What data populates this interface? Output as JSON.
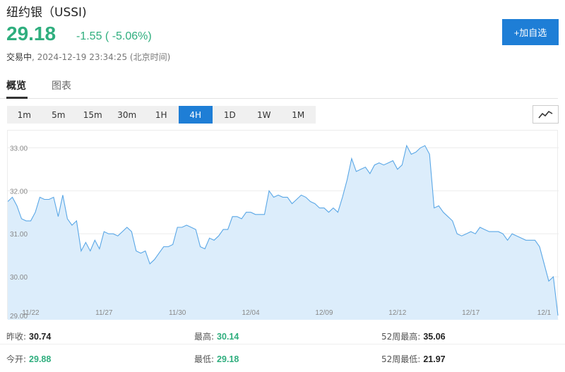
{
  "header": {
    "title": "纽约银（USSI)",
    "price": "29.18",
    "change": "-1.55 ( -5.06%)",
    "status_label": "交易中",
    "timestamp": "2024-12-19 23:34:25 (北京时间)",
    "add_button": "+加自选"
  },
  "tabs": [
    {
      "label": "概览",
      "active": true
    },
    {
      "label": "图表",
      "active": false
    }
  ],
  "periods": [
    {
      "label": "1m"
    },
    {
      "label": "5m"
    },
    {
      "label": "15m"
    },
    {
      "label": "30m"
    },
    {
      "label": "1H"
    },
    {
      "label": "4H",
      "active": true
    },
    {
      "label": "1D"
    },
    {
      "label": "1W"
    },
    {
      "label": "1M"
    }
  ],
  "chart_type_icon": "line-chart-icon",
  "colors": {
    "up_green": "#2fae7e",
    "accent_blue": "#1e7ed6",
    "line": "#5aa7e6",
    "fill": "#dcedfb"
  },
  "stats": {
    "prev_close_label": "昨收:",
    "prev_close": "30.74",
    "high_label": "最高:",
    "high": "30.14",
    "high52_label": "52周最高:",
    "high52": "35.06",
    "open_label": "今开:",
    "open": "29.88",
    "low_label": "最低:",
    "low": "29.18",
    "low52_label": "52周最低:",
    "low52": "21.97"
  },
  "chart_data": {
    "type": "area",
    "ylim": [
      29.0,
      33.4
    ],
    "y_ticks": [
      "33.00",
      "32.00",
      "31.00",
      "30.00",
      "29.00"
    ],
    "x_ticks": [
      {
        "label": "11/22",
        "index": 5
      },
      {
        "label": "11/27",
        "index": 21
      },
      {
        "label": "11/30",
        "index": 37
      },
      {
        "label": "12/04",
        "index": 53
      },
      {
        "label": "12/09",
        "index": 69
      },
      {
        "label": "12/12",
        "index": 85
      },
      {
        "label": "12/17",
        "index": 101
      },
      {
        "label": "12/1",
        "index": 117
      }
    ],
    "values": [
      31.75,
      31.85,
      31.65,
      31.35,
      31.3,
      31.3,
      31.5,
      31.85,
      31.8,
      31.8,
      31.85,
      31.4,
      31.9,
      31.35,
      31.2,
      31.3,
      30.6,
      30.8,
      30.6,
      30.85,
      30.65,
      31.05,
      31.0,
      31.0,
      30.95,
      31.05,
      31.15,
      31.05,
      30.6,
      30.55,
      30.6,
      30.3,
      30.4,
      30.55,
      30.7,
      30.7,
      30.75,
      31.15,
      31.15,
      31.2,
      31.15,
      31.1,
      30.7,
      30.65,
      30.9,
      30.85,
      30.95,
      31.1,
      31.1,
      31.4,
      31.4,
      31.35,
      31.5,
      31.5,
      31.45,
      31.45,
      31.45,
      32.0,
      31.85,
      31.9,
      31.85,
      31.85,
      31.7,
      31.8,
      31.9,
      31.85,
      31.75,
      31.7,
      31.6,
      31.6,
      31.5,
      31.6,
      31.5,
      31.85,
      32.25,
      32.75,
      32.45,
      32.5,
      32.55,
      32.4,
      32.6,
      32.65,
      32.6,
      32.65,
      32.7,
      32.5,
      32.6,
      33.05,
      32.85,
      32.9,
      33.0,
      33.05,
      32.85,
      31.6,
      31.65,
      31.5,
      31.4,
      31.3,
      31.0,
      30.95,
      31.0,
      31.05,
      31.0,
      31.15,
      31.1,
      31.05,
      31.05,
      31.05,
      31.0,
      30.85,
      31.0,
      30.95,
      30.9,
      30.85,
      30.85,
      30.85,
      30.7,
      30.3,
      29.9,
      30.0,
      29.1
    ]
  }
}
